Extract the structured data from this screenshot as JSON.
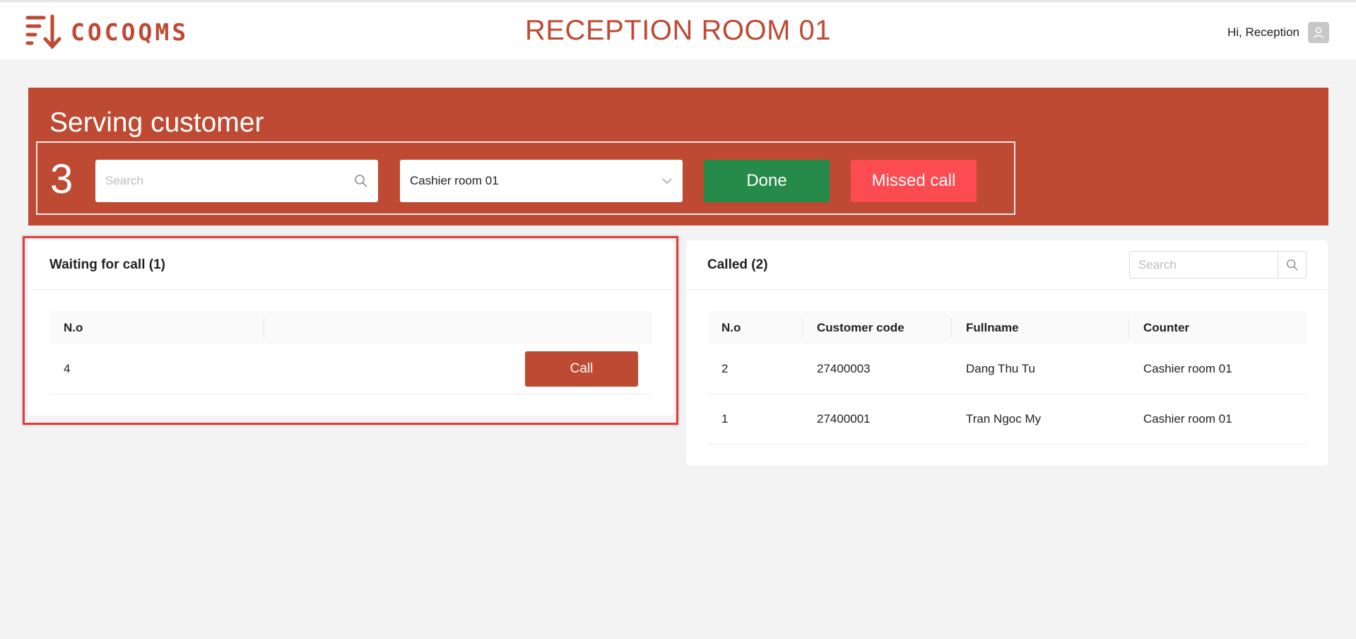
{
  "header": {
    "brand": "COCOQMS",
    "room_title": "RECEPTION ROOM 01",
    "greeting": "Hi, Reception",
    "avatar_icon": "user-icon"
  },
  "serving": {
    "title": "Serving customer",
    "current_number": "3",
    "search_placeholder": "Search",
    "counter_selected": "Cashier room 01",
    "done_label": "Done",
    "missed_label": "Missed call",
    "colors": {
      "banner": "#be4a33",
      "done": "#268a4a",
      "missed": "#fc4b51"
    }
  },
  "waiting": {
    "title": "Waiting for call (1)",
    "columns": [
      "N.o",
      ""
    ],
    "rows": [
      {
        "no": "4",
        "action_label": "Call"
      }
    ]
  },
  "called": {
    "title": "Called (2)",
    "search_placeholder": "Search",
    "columns": [
      "N.o",
      "Customer code",
      "Fullname",
      "Counter"
    ],
    "rows": [
      {
        "no": "2",
        "code": "27400003",
        "name": "Dang Thu Tu",
        "counter": "Cashier room 01"
      },
      {
        "no": "1",
        "code": "27400001",
        "name": "Tran Ngoc My",
        "counter": "Cashier room 01"
      }
    ]
  }
}
